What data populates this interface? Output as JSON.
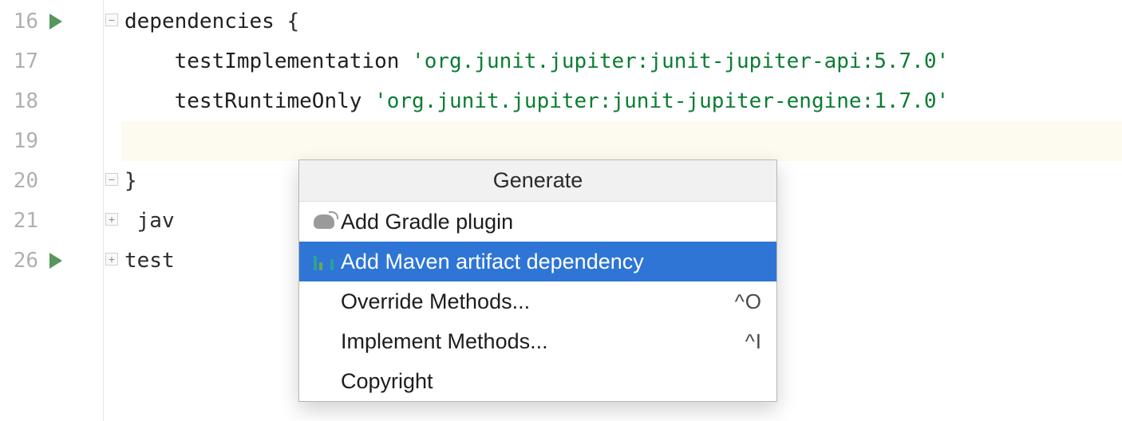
{
  "gutter": {
    "lines": [
      "16",
      "17",
      "18",
      "19",
      "20",
      "21",
      "26"
    ],
    "run_markers": {
      "0": true,
      "6": true
    },
    "fold_markers": {
      "0": "−",
      "4": "−",
      "5": "+",
      "6": "+"
    }
  },
  "code": {
    "r0_kw": "dependencies",
    "r0_brace": " {",
    "indent1": "    ",
    "r1_fn": "testImplementation ",
    "r1_str": "'org.junit.jupiter:junit-jupiter-api:5.7.0'",
    "r2_fn": "testRuntimeOnly ",
    "r2_str": "'org.junit.jupiter:junit-jupiter-engine:1.7.0'",
    "r3_blank": "",
    "r4_close": "}",
    "r5_prefix": " jav",
    "r6_prefix": "test"
  },
  "popup": {
    "title": "Generate",
    "items": [
      {
        "label": "Add Gradle plugin",
        "icon": "gradle",
        "shortcut": "",
        "selected": false
      },
      {
        "label": "Add Maven artifact dependency",
        "icon": "maven",
        "shortcut": "",
        "selected": true
      },
      {
        "label": "Override Methods...",
        "icon": "",
        "shortcut": "^O",
        "selected": false
      },
      {
        "label": "Implement Methods...",
        "icon": "",
        "shortcut": "^I",
        "selected": false
      },
      {
        "label": "Copyright",
        "icon": "",
        "shortcut": "",
        "selected": false
      }
    ]
  }
}
